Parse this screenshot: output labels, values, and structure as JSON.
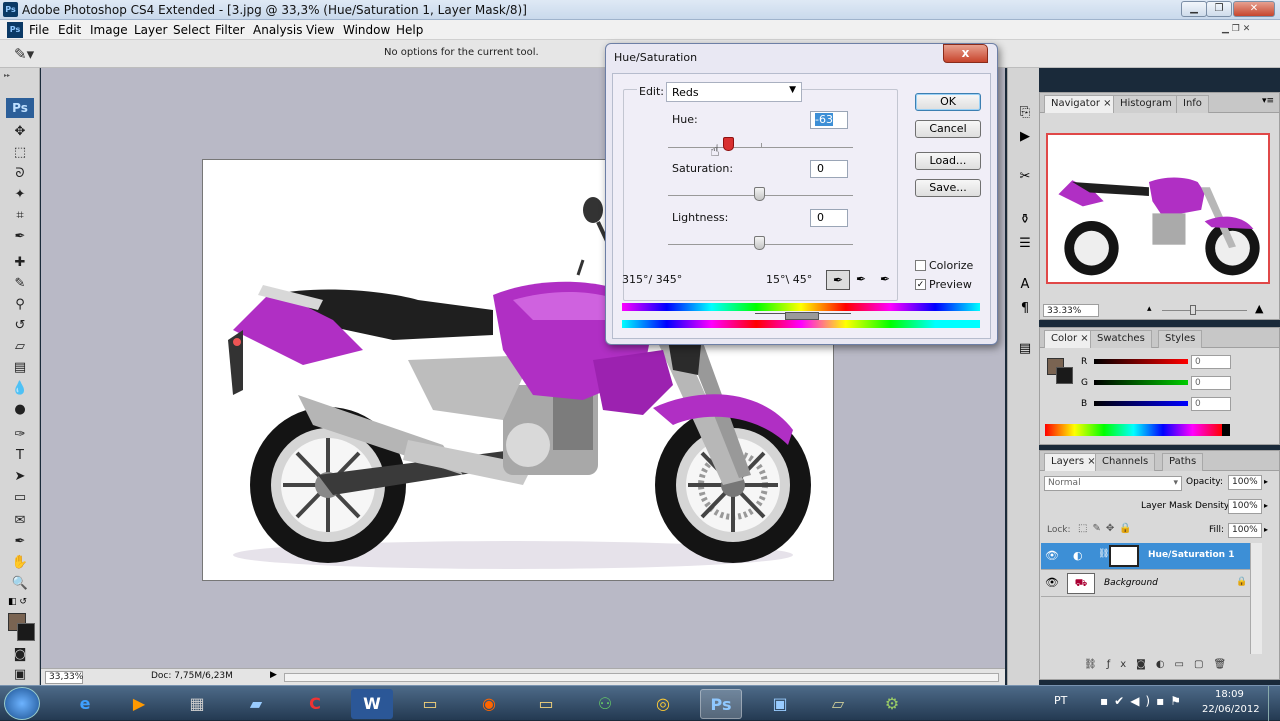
{
  "window": {
    "app_icon": "Ps",
    "title": "Adobe Photoshop CS4 Extended - [3.jpg @ 33,3% (Hue/Saturation 1, Layer Mask/8)]"
  },
  "menu": [
    "File",
    "Edit",
    "Image",
    "Layer",
    "Select",
    "Filter",
    "Analysis",
    "View",
    "Window",
    "Help"
  ],
  "options_bar": {
    "message": "No options for the current tool."
  },
  "toolbox": {
    "badge": "Ps",
    "tools": [
      "move-tool-icon",
      "marquee-tool-icon",
      "lasso-tool-icon",
      "magic-wand-icon",
      "crop-tool-icon",
      "eyedropper-icon",
      "healing-brush-icon",
      "brush-icon",
      "clone-stamp-icon",
      "history-brush-icon",
      "eraser-icon",
      "gradient-icon",
      "blur-icon",
      "dodge-icon",
      "pen-icon",
      "type-tool-icon",
      "path-select-icon",
      "shape-tool-icon",
      "notes-icon",
      "eyedropper-3d-icon",
      "hand-icon",
      "zoom-icon"
    ]
  },
  "status": {
    "zoom": "33,33%",
    "doc": "Doc: 7,75M/6,23M"
  },
  "dialog": {
    "title": "Hue/Saturation",
    "close": "x",
    "edit_label": "Edit:",
    "edit_value": "Reds",
    "hue_label": "Hue:",
    "hue_value": "-63",
    "hue_level": -63,
    "saturation_label": "Saturation:",
    "saturation_value": "0",
    "lightness_label": "Lightness:",
    "lightness_value": "0",
    "range_left": "315°/ 345°",
    "range_right": "15°\\ 45°",
    "buttons": {
      "ok": "OK",
      "cancel": "Cancel",
      "load": "Load...",
      "save": "Save..."
    },
    "colorize_label": "Colorize",
    "colorize_checked": false,
    "preview_label": "Preview",
    "preview_checked": true,
    "check_mark": "✓"
  },
  "navigator": {
    "tabs": [
      "Navigator",
      "Histogram",
      "Info"
    ],
    "zoom": "33.33%"
  },
  "color_panel": {
    "tabs": [
      "Color",
      "Swatches",
      "Styles"
    ],
    "channels": [
      {
        "label": "R",
        "value": "0"
      },
      {
        "label": "G",
        "value": "0"
      },
      {
        "label": "B",
        "value": "0"
      }
    ],
    "foreground": "#7a6452",
    "background": "#1a1a1a"
  },
  "layers_panel": {
    "tabs": [
      "Layers",
      "Channels",
      "Paths"
    ],
    "blend_mode": "Normal",
    "opacity_label": "Opacity:",
    "opacity": "100%",
    "mask_density_label": "Layer Mask Density",
    "mask_density": "100%",
    "lock_label": "Lock:",
    "fill_label": "Fill:",
    "fill": "100%",
    "layers": [
      {
        "name": "Hue/Saturation 1",
        "selected": true
      },
      {
        "name": "Background",
        "selected": false
      }
    ]
  },
  "taskbar": {
    "apps": [
      "ie-icon",
      "media-player-icon",
      "calculator-icon",
      "notepad-icon",
      "ccleaner-icon",
      "word-icon",
      "explorer-icon",
      "firefox-icon",
      "folder-icon",
      "network-icon",
      "chrome-icon",
      "photoshop-icon",
      "screen-icon",
      "notes-icon",
      "app-icon"
    ],
    "ps_label": "Ps",
    "word_label": "W",
    "lang": "PT",
    "time": "18:09",
    "date": "22/06/2012"
  },
  "colors": {
    "accent": "#3d8fd6",
    "moto": "#b02fc4"
  }
}
